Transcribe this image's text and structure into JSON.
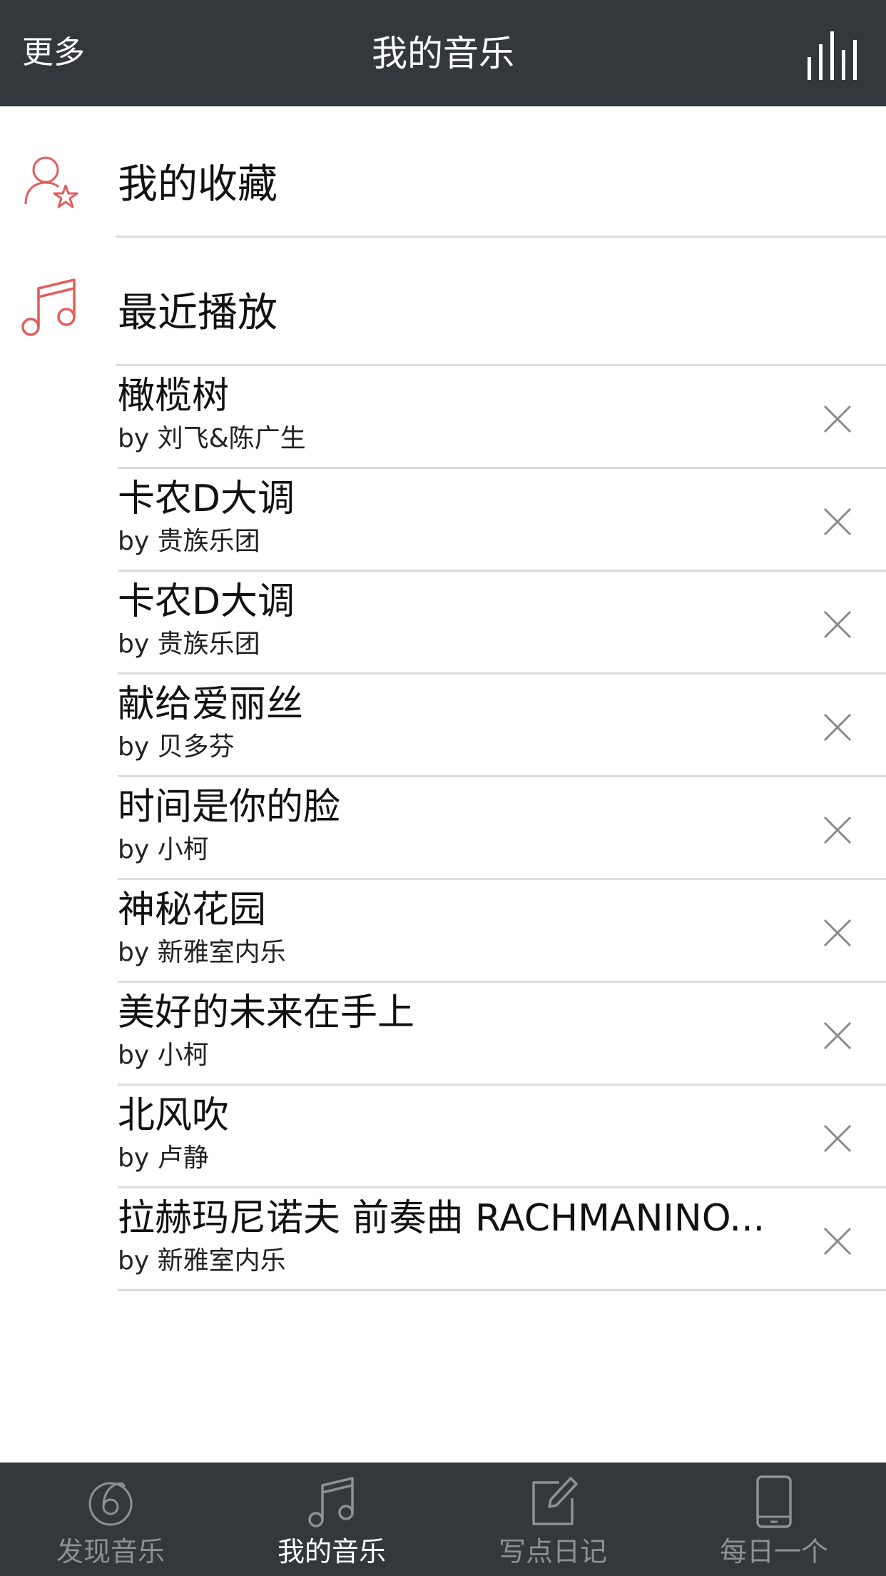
{
  "header": {
    "more_label": "更多",
    "title": "我的音乐",
    "equalizer_icon": "equalizer-icon"
  },
  "sections": {
    "favorites": {
      "label": "我的收藏",
      "icon": "user-star-icon",
      "icon_color": "#e25d5d"
    },
    "recent": {
      "label": "最近播放",
      "icon": "music-note-icon",
      "icon_color": "#e25d5d"
    }
  },
  "recent_songs": [
    {
      "title": "橄榄树",
      "artist": "by 刘飞&陈广生"
    },
    {
      "title": "卡农D大调",
      "artist": "by 贵族乐团"
    },
    {
      "title": "卡农D大调",
      "artist": "by 贵族乐团"
    },
    {
      "title": "献给爱丽丝",
      "artist": "by 贝多芬"
    },
    {
      "title": "时间是你的脸",
      "artist": "by 小柯"
    },
    {
      "title": "神秘花园",
      "artist": "by 新雅室内乐"
    },
    {
      "title": "美好的未来在手上",
      "artist": "by 小柯"
    },
    {
      "title": "北风吹",
      "artist": "by 卢静"
    },
    {
      "title": "拉赫玛尼诺夫 前奏曲 RACHMANINO...",
      "artist": "by 新雅室内乐"
    }
  ],
  "tabbar": {
    "tabs": [
      {
        "label": "发现音乐",
        "icon": "disc-icon",
        "active": false
      },
      {
        "label": "我的音乐",
        "icon": "music-note-icon",
        "active": true
      },
      {
        "label": "写点日记",
        "icon": "edit-icon",
        "active": false
      },
      {
        "label": "每日一个",
        "icon": "phone-icon",
        "active": false
      }
    ]
  },
  "colors": {
    "bar_bg": "#33383c",
    "accent": "#e25d5d",
    "inactive_tab": "#8e9194",
    "divider": "#dcdcdc"
  }
}
